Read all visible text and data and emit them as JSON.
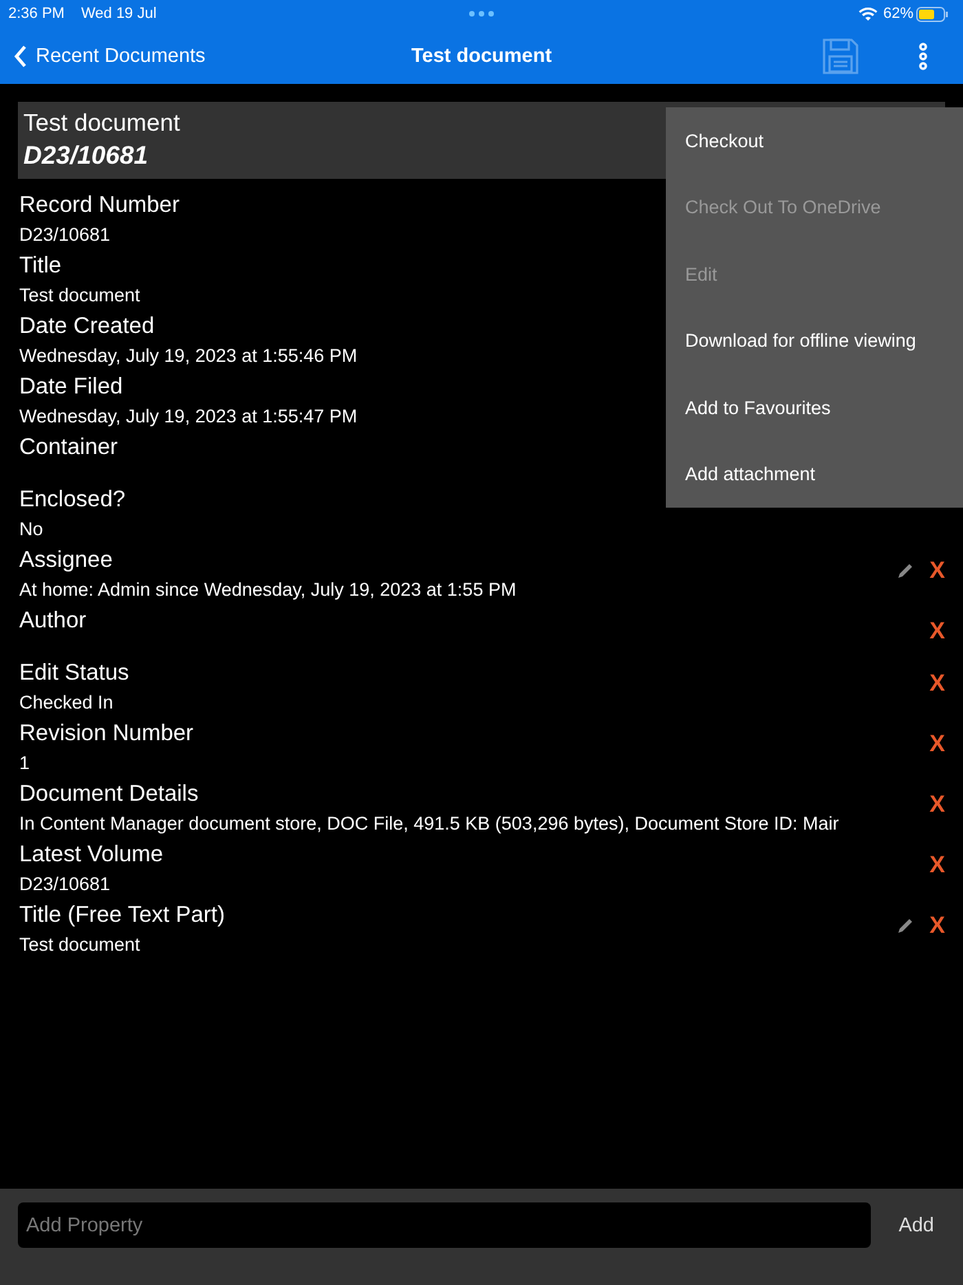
{
  "status_bar": {
    "time": "2:36 PM",
    "date": "Wed 19 Jul",
    "battery": "62%"
  },
  "nav": {
    "back": "Recent Documents",
    "title": "Test document"
  },
  "header": {
    "title": "Test document",
    "record_number": "D23/10681"
  },
  "properties": [
    {
      "label": "Record Number",
      "value": "D23/10681"
    },
    {
      "label": "Title",
      "value": "Test document"
    },
    {
      "label": "Date Created",
      "value": "Wednesday, July 19, 2023 at 1:55:46 PM"
    },
    {
      "label": "Date Filed",
      "value": "Wednesday, July 19, 2023 at 1:55:47 PM"
    },
    {
      "label": "Container"
    },
    {
      "label": "Enclosed?",
      "value": "No"
    },
    {
      "label": "Assignee",
      "value": "At home: Admin since Wednesday, July 19, 2023 at 1:55 PM",
      "editable": true,
      "remove": "X"
    },
    {
      "label": "Author",
      "remove": "X"
    },
    {
      "label": "Edit Status",
      "value": "Checked In",
      "remove": "X"
    },
    {
      "label": "Revision Number",
      "value": "1",
      "remove": "X"
    },
    {
      "label": "Document Details",
      "value": "In Content Manager document store, DOC File, 491.5 KB (503,296 bytes), Document Store ID: Mair",
      "remove": "X"
    },
    {
      "label": "Latest Volume",
      "value": "D23/10681",
      "remove": "X"
    },
    {
      "label": "Title (Free Text Part)",
      "value": "Test document",
      "editable": true,
      "remove": "X"
    }
  ],
  "menu": [
    {
      "label": "Checkout",
      "disabled": false
    },
    {
      "label": "Check Out To OneDrive",
      "disabled": true
    },
    {
      "label": "Edit",
      "disabled": true
    },
    {
      "label": "Download for offline viewing",
      "disabled": false
    },
    {
      "label": "Add to Favourites",
      "disabled": false
    },
    {
      "label": "Add attachment",
      "disabled": false
    }
  ],
  "add_property": {
    "placeholder": "Add Property",
    "button": "Add"
  }
}
